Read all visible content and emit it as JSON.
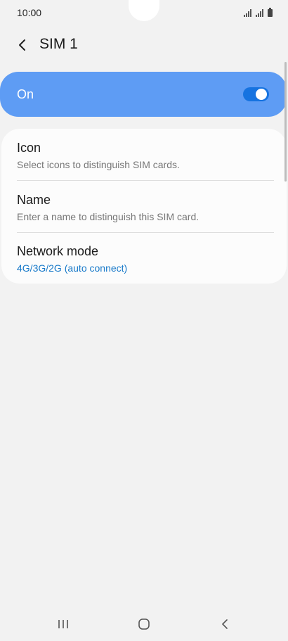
{
  "status_bar": {
    "time": "10:00"
  },
  "header": {
    "title": "SIM 1"
  },
  "master_switch": {
    "label": "On",
    "state": "on",
    "accent": "#5e9cf4"
  },
  "settings": [
    {
      "title": "Icon",
      "subtitle": "Select icons to distinguish SIM cards."
    },
    {
      "title": "Name",
      "subtitle": "Enter a name to distinguish this SIM card."
    },
    {
      "title": "Network mode",
      "subtitle": "4G/3G/2G (auto connect)"
    }
  ],
  "nav_bar": {
    "icons": [
      "recent-apps-icon",
      "home-icon",
      "back-icon"
    ]
  }
}
